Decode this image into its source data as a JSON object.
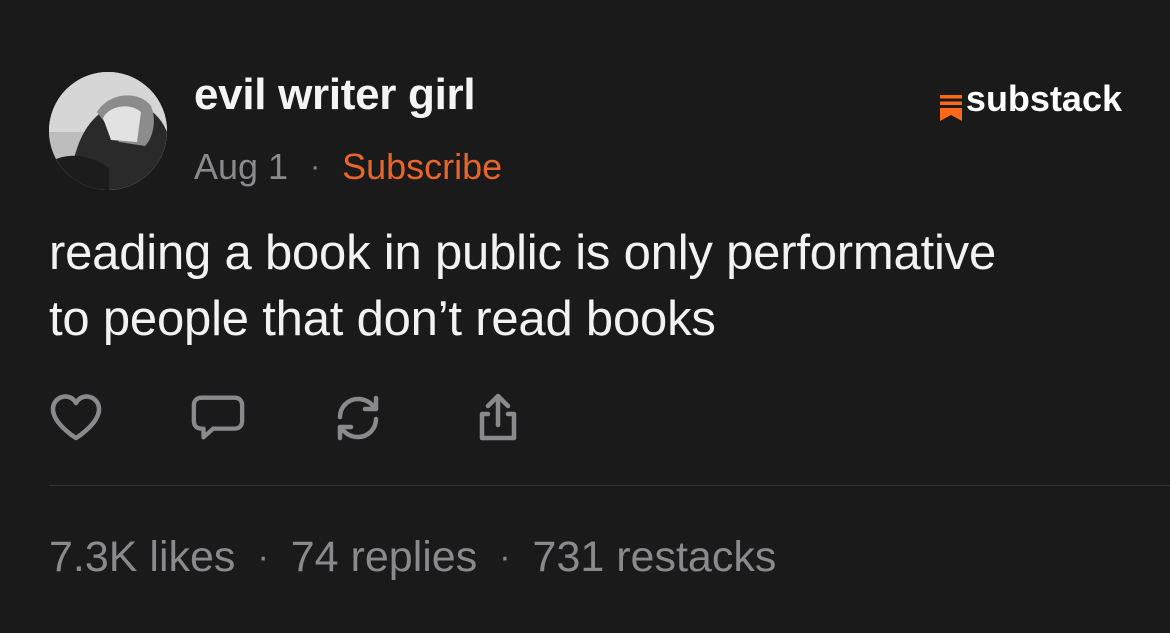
{
  "post": {
    "author": "evil writer girl",
    "date": "Aug 1",
    "separator": "·",
    "subscribe_label": "Subscribe",
    "text_line1": "reading a book in public is only performative",
    "text_line2": "to people that don’t read books"
  },
  "brand": {
    "name": "substack",
    "icon": "substack-logo-icon",
    "color": "#ff6719"
  },
  "actions": [
    {
      "icon": "heart-icon",
      "label": "like"
    },
    {
      "icon": "comment-icon",
      "label": "reply"
    },
    {
      "icon": "restack-icon",
      "label": "restack"
    },
    {
      "icon": "share-icon",
      "label": "share"
    }
  ],
  "stats": {
    "likes": "7.3K likes",
    "replies": "74 replies",
    "restacks": "731 restacks",
    "separator": "·"
  },
  "colors": {
    "background": "#1a1a1b",
    "accent": "#e8652b",
    "muted": "#8a8a8d",
    "text": "#f2f2f2"
  }
}
